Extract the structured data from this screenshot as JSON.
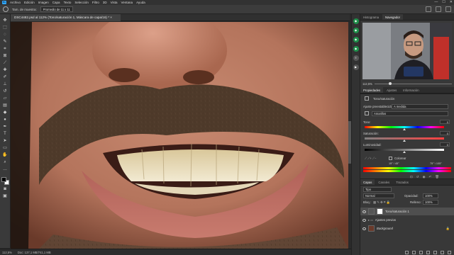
{
  "menu": {
    "logo": "Ps",
    "items": [
      "Archivo",
      "Edición",
      "Imagen",
      "Capa",
      "Texto",
      "Selección",
      "Filtro",
      "3D",
      "Vista",
      "Ventana",
      "Ayuda"
    ],
    "window_controls": [
      "—",
      "☐",
      "✕"
    ]
  },
  "options": {
    "size_label": "Tam. de muestra:",
    "size_value": "Promedio de 11 x 11"
  },
  "document": {
    "tab_title": "DSC4482.psd al 112% (Tono/saturación 1, Máscara de capa/16) *",
    "close": "×"
  },
  "status": {
    "zoom": "112,5%",
    "doc_size": "Doc: 137,1 MB/741,1 MB"
  },
  "navigator": {
    "tabs": [
      "Histograma",
      "Navegador"
    ],
    "zoom": "112,5%"
  },
  "properties": {
    "tabs": [
      "Propiedades",
      "Ajustes",
      "Información"
    ],
    "adjustment_name": "Tono/saturación",
    "preset_label": "Ajuste preestablecido:",
    "preset_value": "A medida",
    "channel_value": "Amarillos",
    "hue_label": "Tono:",
    "hue_value": "0",
    "saturation_label": "Saturación:",
    "saturation_value": "0",
    "lightness_label": "Luminosidad:",
    "lightness_value": "0",
    "colorize_label": "Colorear",
    "range_left": "15° / 45°",
    "range_right": "75° \\ 105°"
  },
  "layers": {
    "tabs": [
      "Capas",
      "Canales",
      "Trazados"
    ],
    "filter": "Tipo",
    "blend_mode": "Normal",
    "opacity_label": "Opacidad:",
    "opacity_value": "100%",
    "lock_label": "Bloq.:",
    "fill_label": "Relleno:",
    "fill_value": "100%",
    "items": [
      {
        "name": "Tono/saturación 1",
        "selected": true
      },
      {
        "name": "Ajustes previos",
        "selected": false
      },
      {
        "name": "Background",
        "selected": false
      }
    ]
  },
  "colors": {
    "accent": "#31a8ff"
  }
}
